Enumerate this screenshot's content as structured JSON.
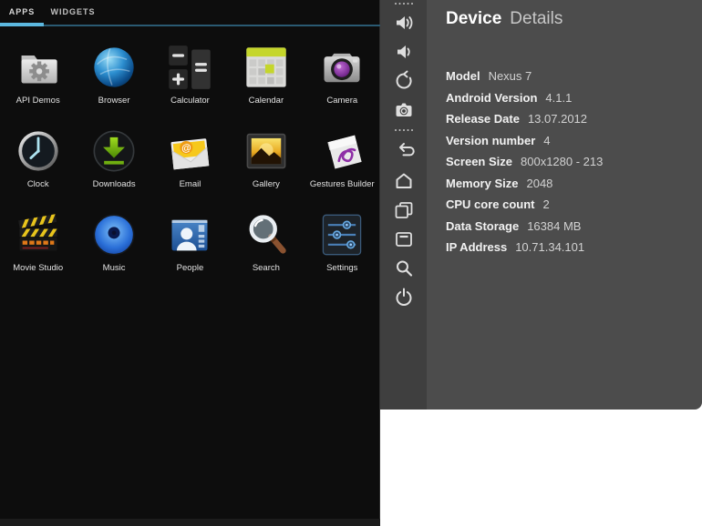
{
  "tabs": [
    {
      "label": "APPS",
      "active": true
    },
    {
      "label": "WIDGETS",
      "active": false
    }
  ],
  "apps": [
    {
      "name": "API Demos"
    },
    {
      "name": "Browser"
    },
    {
      "name": "Calculator"
    },
    {
      "name": "Calendar"
    },
    {
      "name": "Camera"
    },
    {
      "name": "Clock"
    },
    {
      "name": "Downloads"
    },
    {
      "name": "Email"
    },
    {
      "name": "Gallery"
    },
    {
      "name": "Gestures Builder"
    },
    {
      "name": "Movie Studio"
    },
    {
      "name": "Music"
    },
    {
      "name": "People"
    },
    {
      "name": "Search"
    },
    {
      "name": "Settings"
    }
  ],
  "toolbar_icons": [
    "drag-dots",
    "volume-up",
    "volume-down",
    "rotate",
    "camera",
    "drag-dots",
    "back",
    "home",
    "recents",
    "menu",
    "search",
    "power"
  ],
  "details": {
    "title_primary": "Device",
    "title_secondary": "Details",
    "rows": [
      {
        "label": "Model",
        "value": "Nexus 7"
      },
      {
        "label": "Android Version",
        "value": "4.1.1"
      },
      {
        "label": "Release Date",
        "value": "13.07.2012"
      },
      {
        "label": "Version number",
        "value": "4"
      },
      {
        "label": "Screen Size",
        "value": "800x1280 - 213"
      },
      {
        "label": "Memory Size",
        "value": "2048"
      },
      {
        "label": "CPU core count",
        "value": "2"
      },
      {
        "label": "Data Storage",
        "value": "16384 MB"
      },
      {
        "label": "IP Address",
        "value": "10.71.34.101"
      }
    ]
  },
  "colors": {
    "accent_blue": "#5cb8df",
    "tab_line_blue": "#2a5a72",
    "screen_bg": "#0d0d0d",
    "toolbar_bg": "#3f3f3f",
    "panel_bg": "#4c4c4c"
  }
}
